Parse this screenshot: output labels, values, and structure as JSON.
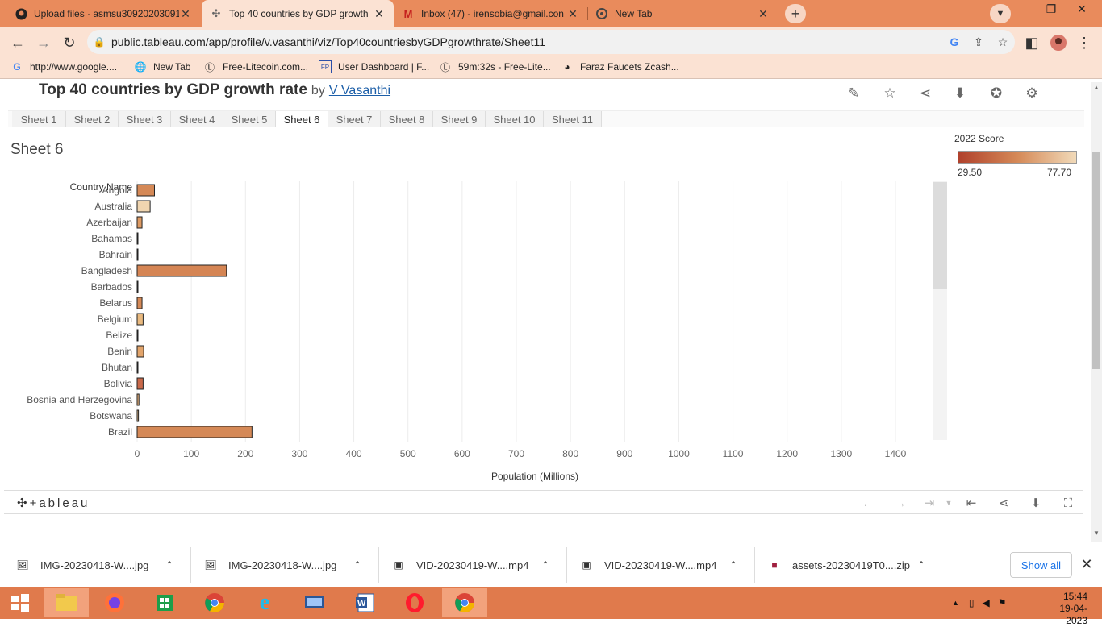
{
  "browser": {
    "tabs": [
      {
        "title": "Upload files · asmsu30920203091",
        "icon": "github-icon"
      },
      {
        "title": "Top 40 countries by GDP growth",
        "icon": "tableau-icon"
      },
      {
        "title": "Inbox (47) - irensobia@gmail.con",
        "icon": "gmail-icon"
      },
      {
        "title": "New Tab",
        "icon": "chrome-icon"
      }
    ],
    "url": "public.tableau.com/app/profile/v.vasanthi/viz/Top40countriesbyGDPgrowthrate/Sheet11",
    "bookmarks": [
      {
        "label": "http://www.google...."
      },
      {
        "label": "New Tab"
      },
      {
        "label": "Free-Litecoin.com..."
      },
      {
        "label": "User Dashboard | F..."
      },
      {
        "label": "59m:32s - Free-Lite..."
      },
      {
        "label": "Faraz Faucets Zcash..."
      }
    ]
  },
  "viz": {
    "title": "Top 40 countries by GDP growth rate",
    "by": "by",
    "author": "V Vasanthi",
    "sheet_tabs": [
      "Sheet 1",
      "Sheet 2",
      "Sheet 3",
      "Sheet 4",
      "Sheet 5",
      "Sheet 6",
      "Sheet 7",
      "Sheet 8",
      "Sheet 9",
      "Sheet 10",
      "Sheet 11"
    ],
    "active_sheet": "Sheet 6",
    "sheet_title": "Sheet 6",
    "legend": {
      "title": "2022 Score",
      "min": "29.50",
      "max": "77.70"
    },
    "footer_logo": "+ableau"
  },
  "chart_data": {
    "type": "bar",
    "orientation": "horizontal",
    "row_header": "Country Name",
    "xlabel": "Population (Millions)",
    "xlim": [
      0,
      1400
    ],
    "xticks": [
      0,
      100,
      200,
      300,
      400,
      500,
      600,
      700,
      800,
      900,
      1000,
      1100,
      1200,
      1300,
      1400
    ],
    "color_legend": "2022 Score",
    "categories": [
      "Angola",
      "Australia",
      "Azerbaijan",
      "Bahamas",
      "Bahrain",
      "Bangladesh",
      "Barbados",
      "Belarus",
      "Belgium",
      "Belize",
      "Benin",
      "Bhutan",
      "Bolivia",
      "Bosnia and Herzegovina",
      "Botswana",
      "Brazil"
    ],
    "values": [
      32,
      24,
      9,
      0.4,
      1.5,
      165,
      0.3,
      9,
      11,
      0.4,
      12,
      0.8,
      11,
      3.3,
      2.4,
      212
    ],
    "colors": [
      "#d58957",
      "#f0d5b0",
      "#dd9a63",
      "#e8b780",
      "#e3a96f",
      "#d58554",
      "#e9bb86",
      "#d58957",
      "#e9b97f",
      "#dfa26a",
      "#e2a46b",
      "#e6b07a",
      "#c9694a",
      "#e5b07b",
      "#eac08d",
      "#d58957"
    ]
  },
  "downloads": [
    {
      "name": "IMG-20230418-W....jpg"
    },
    {
      "name": "IMG-20230418-W....jpg"
    },
    {
      "name": "VID-20230419-W....mp4"
    },
    {
      "name": "VID-20230419-W....mp4"
    },
    {
      "name": "assets-20230419T0....zip"
    }
  ],
  "downloads_show_all": "Show all",
  "clock": {
    "time": "15:44",
    "date": "19-04-2023"
  }
}
